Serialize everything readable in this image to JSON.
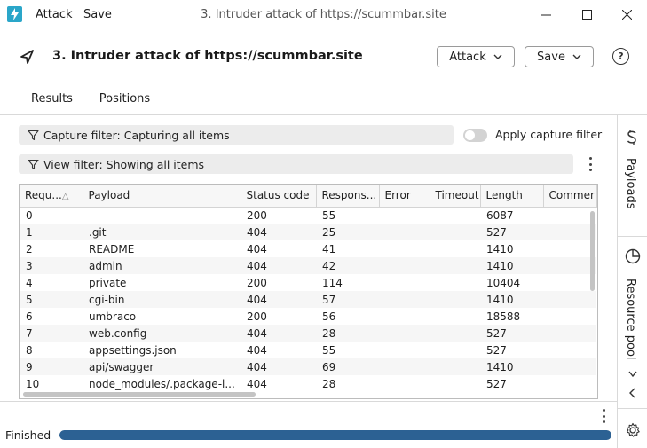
{
  "window": {
    "menu": [
      "Attack",
      "Save"
    ],
    "title": "3. Intruder attack of https://scummbar.site"
  },
  "header": {
    "title": "3. Intruder attack of https://scummbar.site",
    "attack_label": "Attack",
    "save_label": "Save",
    "help_glyph": "?"
  },
  "tabs": [
    "Results",
    "Positions"
  ],
  "filters": {
    "capture": "Capture filter: Capturing all items",
    "apply_capture": "Apply capture filter",
    "view": "View filter: Showing all items"
  },
  "table": {
    "columns": [
      "Requ...",
      "Payload",
      "Status code",
      "Respons...",
      "Error",
      "Timeout",
      "Length",
      "Commer"
    ],
    "sorted_column": "Requ...",
    "sort_glyph": "△",
    "rows": [
      [
        "0",
        "",
        "200",
        "55",
        "",
        "",
        "6087",
        ""
      ],
      [
        "1",
        ".git",
        "404",
        "25",
        "",
        "",
        "527",
        ""
      ],
      [
        "2",
        "README",
        "404",
        "41",
        "",
        "",
        "1410",
        ""
      ],
      [
        "3",
        "admin",
        "404",
        "42",
        "",
        "",
        "1410",
        ""
      ],
      [
        "4",
        "private",
        "200",
        "114",
        "",
        "",
        "10404",
        ""
      ],
      [
        "5",
        "cgi-bin",
        "404",
        "57",
        "",
        "",
        "1410",
        ""
      ],
      [
        "6",
        "umbraco",
        "200",
        "56",
        "",
        "",
        "18588",
        ""
      ],
      [
        "7",
        "web.config",
        "404",
        "28",
        "",
        "",
        "527",
        ""
      ],
      [
        "8",
        "appsettings.json",
        "404",
        "55",
        "",
        "",
        "527",
        ""
      ],
      [
        "9",
        "api/swagger",
        "404",
        "69",
        "",
        "",
        "1410",
        ""
      ],
      [
        "10",
        "node_modules/.package-l...",
        "404",
        "28",
        "",
        "",
        "527",
        ""
      ]
    ]
  },
  "side_panel": {
    "payloads": "Payloads",
    "resource_pool": "Resource pool",
    "chevron_down": "›",
    "chevron_left": "‹"
  },
  "status": {
    "text": "Finished",
    "progress": 1.0
  },
  "colors": {
    "accent_tab": "#e8632b",
    "progress": "#2c6193",
    "logo": "#2aa6c9"
  },
  "icons": {
    "app": "burp-logo-icon",
    "back": "send-arrow-icon",
    "help": "help-circle-icon",
    "filter": "funnel-icon",
    "payloads": "dollar-icon",
    "resource_pool": "pie-chart-icon",
    "settings": "gear-icon"
  }
}
